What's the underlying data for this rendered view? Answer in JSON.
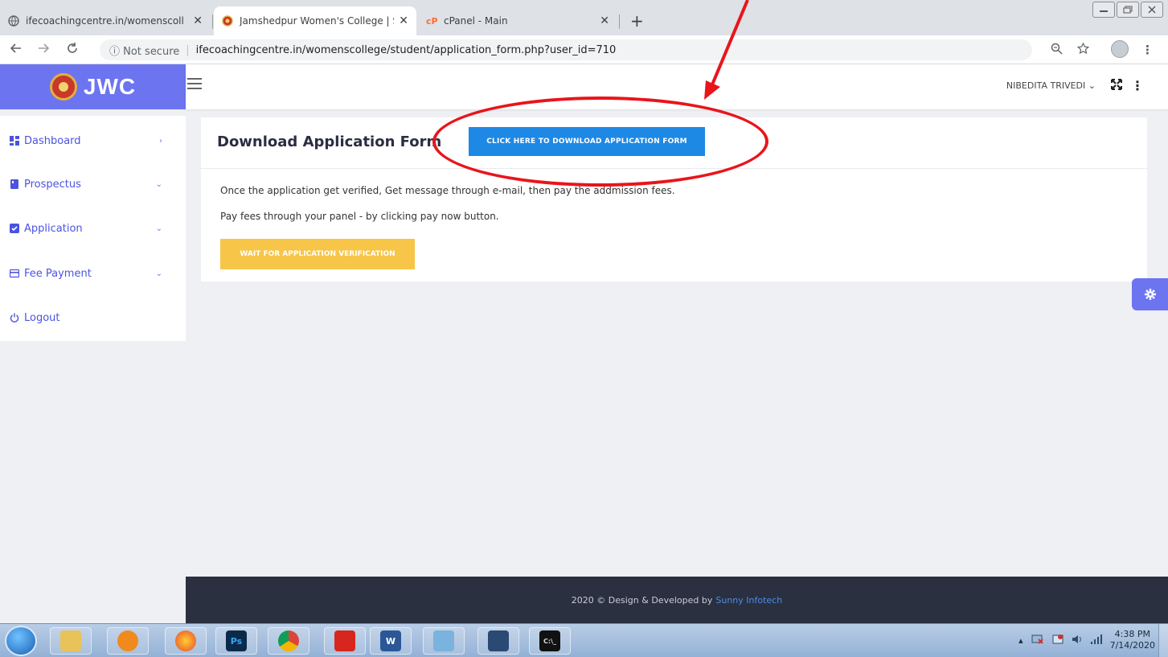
{
  "browser": {
    "tabs": [
      {
        "title": "ifecoachingcentre.in/womenscoll",
        "active": false
      },
      {
        "title": "Jamshedpur Women's College | S",
        "active": true
      },
      {
        "title": "cPanel - Main",
        "active": false
      }
    ],
    "tab_close": "✕",
    "new_tab": "+",
    "security_label": "ⓘ Not secure",
    "url": "ifecoachingcentre.in/womenscollege/student/application_form.php?user_id=710"
  },
  "header": {
    "brand": "JWC",
    "user_name": "NIBEDITA TRIVEDI",
    "user_chevron": "⌄"
  },
  "sidebar": {
    "items": [
      {
        "label": "Dashboard",
        "chevron": "›"
      },
      {
        "label": "Prospectus",
        "chevron": "⌄"
      },
      {
        "label": "Application",
        "chevron": "⌄"
      },
      {
        "label": "Fee Payment",
        "chevron": "⌄"
      },
      {
        "label": "Logout",
        "chevron": ""
      }
    ]
  },
  "main": {
    "title": "Download Application Form",
    "download_button": "CLICK HERE TO DOWNLOAD APPLICATION FORM",
    "paragraphs": [
      "Once the application get verified, Get message through e-mail, then pay the addmission fees.",
      "Pay fees through your panel - by clicking pay now button."
    ],
    "wait_button": "WAIT FOR APPLICATION VERIFICATION"
  },
  "footer": {
    "text": "2020 © Design & Developed by",
    "link": "Sunny Infotech"
  },
  "taskbar": {
    "photoshop_label": "Ps",
    "word_label": "W",
    "cmd_label": "C:\\_",
    "time": "4:38 PM",
    "date": "7/14/2020"
  },
  "colors": {
    "brand": "#6c74f0",
    "primary_button": "#1e88e5",
    "warning_button": "#f7c548",
    "annotation": "#e8151b",
    "footer_bg": "#2a3040"
  }
}
